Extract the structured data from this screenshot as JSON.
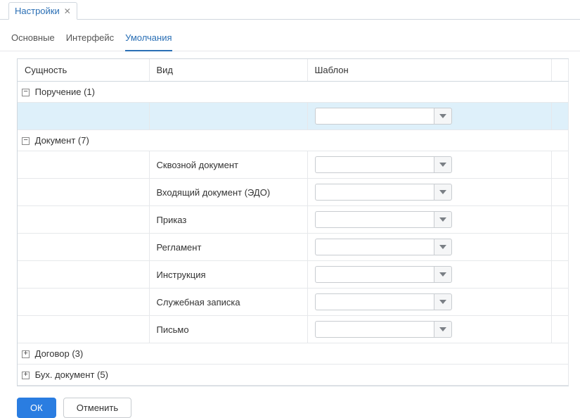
{
  "windowTab": {
    "label": "Настройки"
  },
  "navTabs": {
    "basic": "Основные",
    "interface": "Интерфейс",
    "defaults": "Умолчания"
  },
  "columns": {
    "entity": "Сущность",
    "kind": "Вид",
    "template": "Шаблон"
  },
  "groups": {
    "assignment": {
      "label": "Поручение (1)",
      "expanded": true
    },
    "document": {
      "label": "Документ (7)",
      "expanded": true
    },
    "contract": {
      "label": "Договор (3)",
      "expanded": false
    },
    "accounting": {
      "label": "Бух. документ (5)",
      "expanded": false
    }
  },
  "documentKinds": {
    "through": "Сквозной документ",
    "incoming": "Входящий документ (ЭДО)",
    "order": "Приказ",
    "regulation": "Регламент",
    "instruction": "Инструкция",
    "memo": "Служебная записка",
    "letter": "Письмо"
  },
  "buttons": {
    "ok": "ОК",
    "cancel": "Отменить"
  }
}
